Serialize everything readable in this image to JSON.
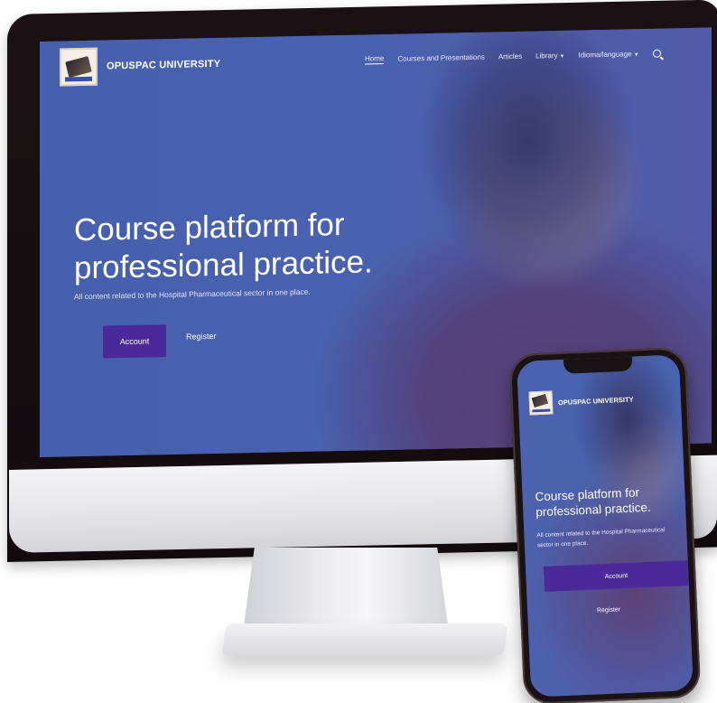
{
  "brand": {
    "name": "OPUSPAC UNIVERSITY"
  },
  "nav": {
    "items": [
      {
        "label": "Home",
        "active": true
      },
      {
        "label": "Courses and Presentations"
      },
      {
        "label": "Articles"
      },
      {
        "label": "Library",
        "has_caret": true
      },
      {
        "label": "Idioma/language",
        "has_caret": true
      }
    ],
    "search_icon": "search-icon"
  },
  "hero": {
    "title": "Course platform for professional practice.",
    "subtitle": "All content related to the Hospital Pharmaceutical sector in one place.",
    "account_label": "Account",
    "register_label": "Register"
  },
  "mobile": {
    "brand_name": "OPUSPAC UNIVERSITY",
    "title": "Course platform for professional practice.",
    "subtitle": "All content related to the Hospital Pharmaceutical sector in one place.",
    "account_label": "Account",
    "register_label": "Register"
  },
  "colors": {
    "overlay_blue": "#3f54aa",
    "button_purple": "#4a2a98",
    "sweater_red": "#7a2d43"
  }
}
